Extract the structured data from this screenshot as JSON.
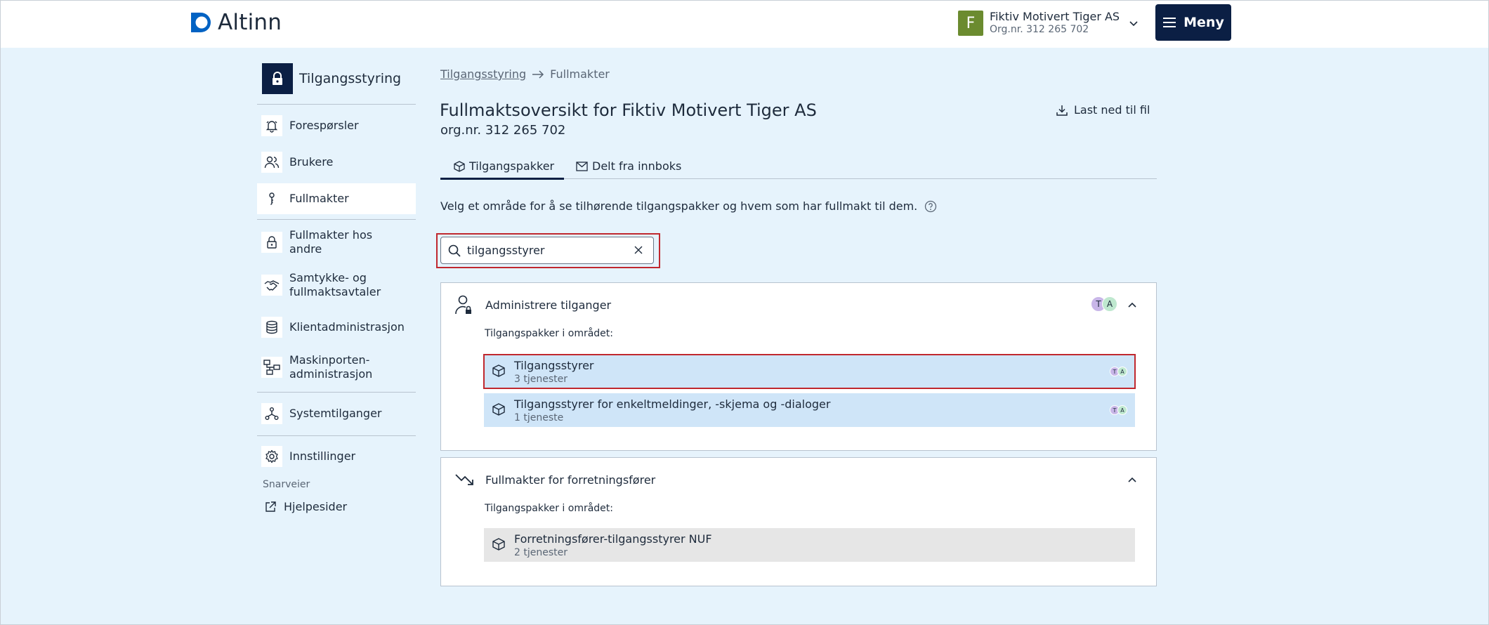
{
  "header": {
    "logo_text": "Altinn",
    "org": {
      "initial": "F",
      "name": "Fiktiv Motivert Tiger AS",
      "nr": "Org.nr. 312 265 702",
      "avatar_color": "#6b8b2f"
    },
    "menu_label": "Meny"
  },
  "sidebar": {
    "title": "Tilgangsstyring",
    "items": [
      {
        "label": "Forespørsler",
        "icon": "bell-icon"
      },
      {
        "label": "Brukere",
        "icon": "users-icon"
      },
      {
        "label": "Fullmakter",
        "icon": "key-icon",
        "active": true
      },
      {
        "label": "Fullmakter hos andre",
        "icon": "padlock-icon"
      },
      {
        "label": "Samtykke- og fullmaktsavtaler",
        "icon": "handshake-icon"
      },
      {
        "label": "Klientadministrasjon",
        "icon": "database-icon"
      },
      {
        "label": "Maskinporten-administrasjon",
        "icon": "network-icon"
      },
      {
        "label": "Systemtilganger",
        "icon": "nodes-icon"
      },
      {
        "label": "Innstillinger",
        "icon": "gear-icon"
      }
    ],
    "shortcuts_label": "Snarveier",
    "help_label": "Hjelpesider"
  },
  "breadcrumb": {
    "root": "Tilgangsstyring",
    "current": "Fullmakter"
  },
  "page": {
    "title": "Fullmaktsoversikt for Fiktiv Motivert Tiger AS",
    "subtitle": "org.nr. 312 265 702",
    "download_label": "Last ned til fil",
    "tabs": [
      {
        "label": "Tilgangspakker",
        "active": true
      },
      {
        "label": "Delt fra innboks",
        "active": false
      }
    ],
    "intro": "Velg et område for å se tilhørende tilgangspakker og hvem som har fullmakt til dem."
  },
  "search": {
    "value": "tilgangsstyrer"
  },
  "areas": [
    {
      "title": "Administrere tilganger",
      "sub": "Tilgangspakker i området:",
      "avatars": [
        "T",
        "A"
      ],
      "packages": [
        {
          "title": "Tilgangsstyrer",
          "count": "3 tjenester",
          "avatars": [
            "T",
            "A"
          ]
        },
        {
          "title": "Tilgangsstyrer for enkeltmeldinger, -skjema og -dialoger",
          "count": "1 tjeneste",
          "avatars": [
            "T",
            "A"
          ]
        }
      ]
    },
    {
      "title": "Fullmakter for forretningsfører",
      "sub": "Tilgangspakker i området:",
      "packages": [
        {
          "title": "Forretningsfører-tilgangsstyrer NUF",
          "count": "2 tjenester"
        }
      ]
    }
  ],
  "colors": {
    "brand": "#0b1f44",
    "highlight": "#c0282e",
    "avatar_t": "#c8b6e8",
    "avatar_a": "#bfe8cf"
  }
}
